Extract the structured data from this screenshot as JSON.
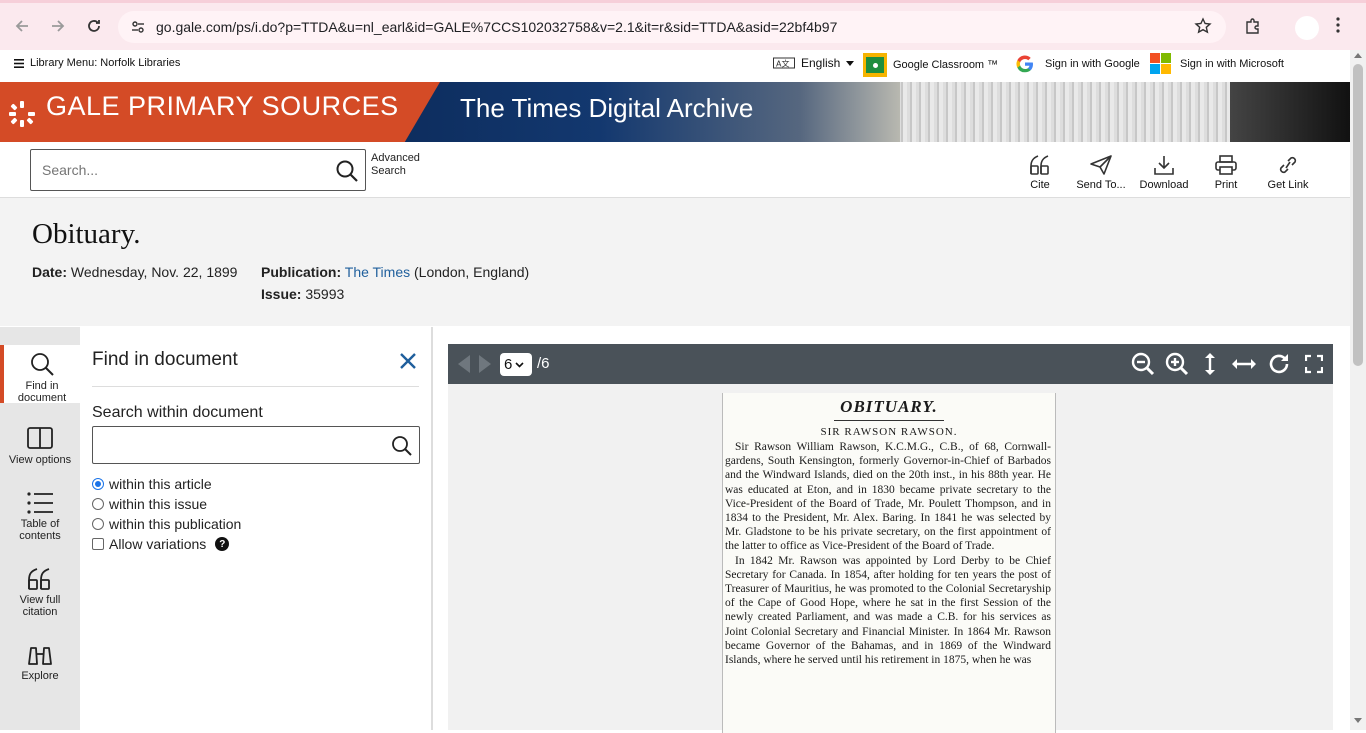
{
  "browser": {
    "url": "go.gale.com/ps/i.do?p=TTDA&u=nl_earl&id=GALE%7CCS102032758&v=2.1&it=r&sid=TTDA&asid=22bf4b97"
  },
  "utility": {
    "library_menu": "Library Menu: Norfolk Libraries",
    "language": "English",
    "google_classroom": "Google Classroom ™",
    "sign_in_google": "Sign in with Google",
    "sign_in_microsoft": "Sign in with Microsoft"
  },
  "banner": {
    "brand": "GALE PRIMARY SOURCES",
    "collection": "The Times Digital Archive",
    "brand_color": "#d44b26"
  },
  "toolbar": {
    "search_placeholder": "Search...",
    "advanced_line1": "Advanced",
    "advanced_line2": "Search",
    "cite": "Cite",
    "send_to": "Send To...",
    "download": "Download",
    "print": "Print",
    "get_link": "Get Link"
  },
  "document": {
    "title": "Obituary.",
    "date_label": "Date:",
    "date_value": "Wednesday,  Nov. 22, 1899",
    "publication_label": "Publication:",
    "publication_name": "The Times",
    "publication_place": "(London, England)",
    "issue_label": "Issue:",
    "issue_value": "35993"
  },
  "rail": {
    "find_line1": "Find in",
    "find_line2": "document",
    "view_options": "View options",
    "toc_line1": "Table of",
    "toc_line2": "contents",
    "citation_line1": "View full",
    "citation_line2": "citation",
    "explore": "Explore"
  },
  "find_panel": {
    "heading": "Find in document",
    "search_within_label": "Search within document",
    "search_within_value": "",
    "options": [
      "within this article",
      "within this issue",
      "within this publication"
    ],
    "selected_option": "within this article",
    "allow_variations": "Allow variations"
  },
  "viewer": {
    "current_page": "6",
    "total_pages": "/6",
    "page": {
      "heading": "OBITUARY.",
      "subheading": "SIR RAWSON RAWSON.",
      "paragraph1": "Sir Rawson William Rawson, K.C.M.G., C.B., of 68, Cornwall-gardens, South Kensington, formerly Governor-in-Chief of Barbados and the Windward Islands, died on the 20th inst., in his 88th year. He was educated at Eton, and in 1830 became private secretary to the Vice-President of the Board of Trade, Mr. Poulett Thompson, and in 1834 to the President, Mr. Alex. Baring. In 1841 he was selected by Mr. Gladstone to be his private secretary, on the first appointment of the latter to office as Vice-President of the Board of Trade.",
      "paragraph2": "In 1842 Mr. Rawson was appointed by Lord Derby to be Chief Secretary for Canada. In 1854, after holding for ten years the post of Treasurer of Mauritius, he was promoted to the Colonial Secretaryship of the Cape of Good Hope, where he sat in the first Session of the newly created Parliament, and was made a C.B. for his services as Joint Colonial Secretary and Financial Minister. In 1864 Mr. Rawson became Governor of the Bahamas, and in 1869 of the Windward Islands, where he served until his retirement in 1875, when he was"
    }
  }
}
